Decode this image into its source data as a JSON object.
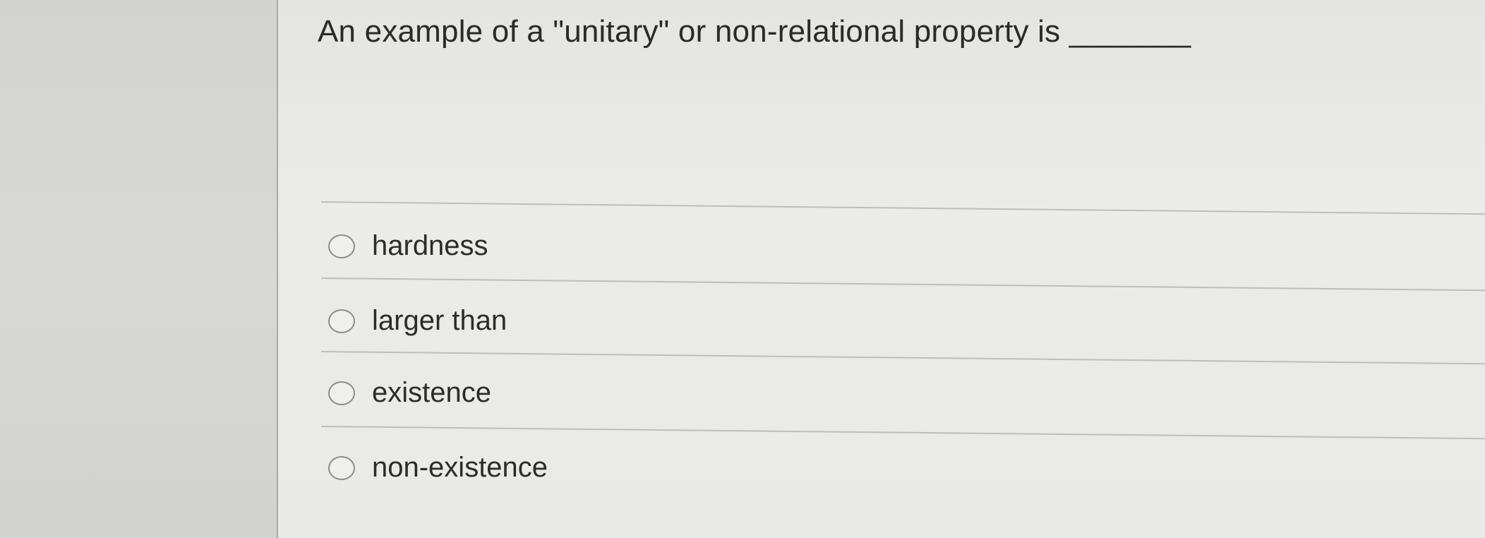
{
  "question": {
    "text": "An example of a \"unitary\" or non-relational property is _______"
  },
  "options": [
    {
      "label": "hardness",
      "selected": false
    },
    {
      "label": "larger than",
      "selected": false
    },
    {
      "label": "existence",
      "selected": false
    },
    {
      "label": "non-existence",
      "selected": false
    }
  ]
}
